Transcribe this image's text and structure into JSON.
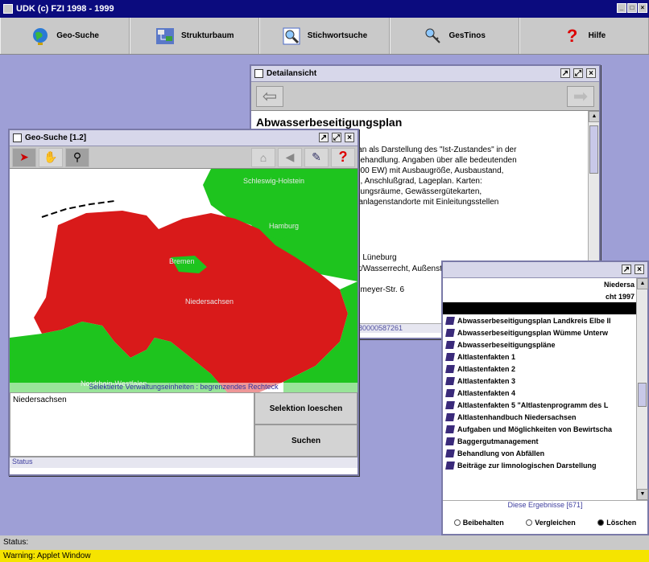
{
  "window": {
    "title": "UDK (c) FZI 1998 - 1999"
  },
  "toolbar": {
    "items": [
      {
        "label": "Geo-Suche",
        "icon": "globe-icon"
      },
      {
        "label": "Strukturbaum",
        "icon": "tree-icon"
      },
      {
        "label": "Stichwortsuche",
        "icon": "magnifier-icon"
      },
      {
        "label": "GesTinos",
        "icon": "key-icon"
      },
      {
        "label": "Hilfe",
        "icon": "question-icon"
      }
    ]
  },
  "detail": {
    "title": "Detailansicht",
    "heading": "Abwasserbeseitigungsplan",
    "lines": [
      "lan als Darstellung des \"Ist-Zustandes\" in der",
      "behandlung. Angaben über alle bedeutenden",
      "000 EW) mit Ausbaugröße, Ausbaustand,",
      "n, Anschlußgrad, Lageplan. Karten:",
      "nungsräume, Gewässergütekarten,",
      "ranlagenstandorte mit Einleitungsstellen",
      "g Lüneburg",
      "rt/Wasserrecht, Außenstelle Verden",
      "nmeyer-Str. 6"
    ],
    "footer": "-80000587261"
  },
  "results": {
    "list": [
      {
        "label": "Niedersa",
        "selected": false
      },
      {
        "label": "cht 1997",
        "selected": false
      },
      {
        "label": "",
        "selected": true
      },
      {
        "label": "Abwasserbeseitigungsplan Landkreis Elbe II",
        "selected": false
      },
      {
        "label": "Abwasserbeseitigungsplan Wümme Unterw",
        "selected": false
      },
      {
        "label": "Abwasserbeseitigungspläne",
        "selected": false
      },
      {
        "label": "Altlastenfakten 1",
        "selected": false
      },
      {
        "label": "Altlastenfakten 2",
        "selected": false
      },
      {
        "label": "Altlastenfakten 3",
        "selected": false
      },
      {
        "label": "Altlastenfakten 4",
        "selected": false
      },
      {
        "label": "Altlastenfakten 5 \"Altlastenprogramm des L",
        "selected": false
      },
      {
        "label": "Altlastenhandbuch Niedersachsen",
        "selected": false
      },
      {
        "label": "Aufgaben und Möglichkeiten von Bewirtscha",
        "selected": false
      },
      {
        "label": "Baggergutmanagement",
        "selected": false
      },
      {
        "label": "Behandlung von Abfällen",
        "selected": false
      },
      {
        "label": "Beiträge zur limnologischen Darstellung",
        "selected": false
      }
    ],
    "footer": "Diese Ergebnisse [671]",
    "radios": [
      {
        "label": "Beibehalten",
        "checked": false
      },
      {
        "label": "Vergleichen",
        "checked": false
      },
      {
        "label": "Löschen",
        "checked": true
      }
    ]
  },
  "geo": {
    "title": "Geo-Suche [1.2]",
    "tools": [
      {
        "icon": "arrow-pointer-icon",
        "glyph": "➤",
        "pressed": true
      },
      {
        "icon": "hand-icon",
        "glyph": "✋",
        "pressed": false
      },
      {
        "icon": "zoom-icon",
        "glyph": "🔍",
        "pressed": true
      },
      {
        "icon": "home-icon",
        "glyph": "⌂",
        "pressed": false
      },
      {
        "icon": "back-icon",
        "glyph": "◀",
        "pressed": false
      },
      {
        "icon": "wand-icon",
        "glyph": "✎",
        "pressed": false
      },
      {
        "icon": "help-icon",
        "glyph": "?",
        "pressed": false
      }
    ],
    "map_labels": {
      "schleswig": "Schleswig-Holstein",
      "hamburg": "Hamburg",
      "bremen": "Bremen",
      "niedersachsen": "Niedersachsen",
      "nrw": "Nordrhein-Westfalen"
    },
    "map_caption": "Selektierte Verwaltungseinheiten : begrenzendes Rechteck",
    "selection_text": "Niedersachsen",
    "buttons": {
      "clear": "Selektion loeschen",
      "search": "Suchen"
    },
    "status": "Status"
  },
  "app_status": "Status:",
  "warning": "Warning: Applet Window",
  "colors": {
    "selected_region": "#d91a1a",
    "other_region": "#1ec41e",
    "desktop": "#9e9fd6"
  }
}
